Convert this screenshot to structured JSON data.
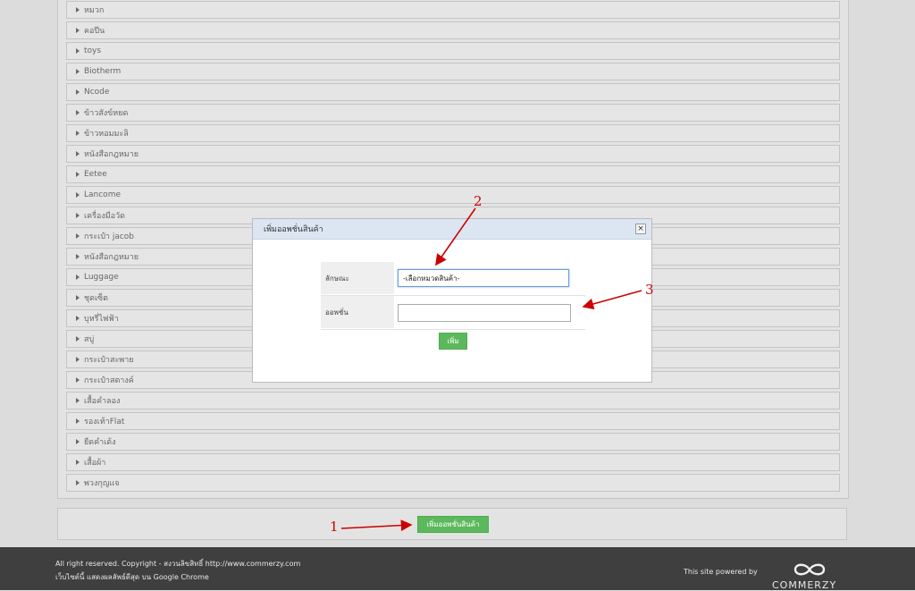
{
  "categories": [
    "หมวก",
    "คอปีน",
    "toys",
    "Biotherm",
    "Ncode",
    "ข้าวสังข์หยด",
    "ข้าวหอมมะลิ",
    "หนังสือกฎหมาย",
    "Eetee",
    "Lancome",
    "เครื่องมือวัด",
    "กระเป๋า jacob",
    "หนังสือกฎหมาย",
    "Luggage",
    "ชุดเซ็ต",
    "บุหรี่ไฟฟ้า",
    "สบู่",
    "กระเป๋าสะพาย",
    "กระเป๋าสตางค์",
    "เสื้อคำลอง",
    "รองเท้าFlat",
    "ยืดคำเด้ง",
    "เสื้อผ้า",
    "พวงกุญแจ"
  ],
  "bottom": {
    "add_option_button": "เพิ่มออพชั่นสินค้า"
  },
  "modal": {
    "title": "เพิ่มออพชั่นสินค้า",
    "close_icon": "×",
    "fields": {
      "type_label": "ลักษณะ",
      "type_value": "-เลือกหมวดสินค้า-",
      "option_label": "ออพชั่น",
      "option_value": ""
    },
    "submit_button": "เพิ่ม"
  },
  "annotations": {
    "one": "1",
    "two": "2",
    "three": "3",
    "color": "#cc0000"
  },
  "footer": {
    "copyright": "All right reserved. Copyright - สงวนลิขสิทธิ์ http://www.commerzy.com",
    "browser_note": "เว็บไซต์นี้ แสดงผลลัพธ์ดีสุด บน Google Chrome",
    "powered_by": "This site powered by",
    "brand": "COMMERZY"
  }
}
